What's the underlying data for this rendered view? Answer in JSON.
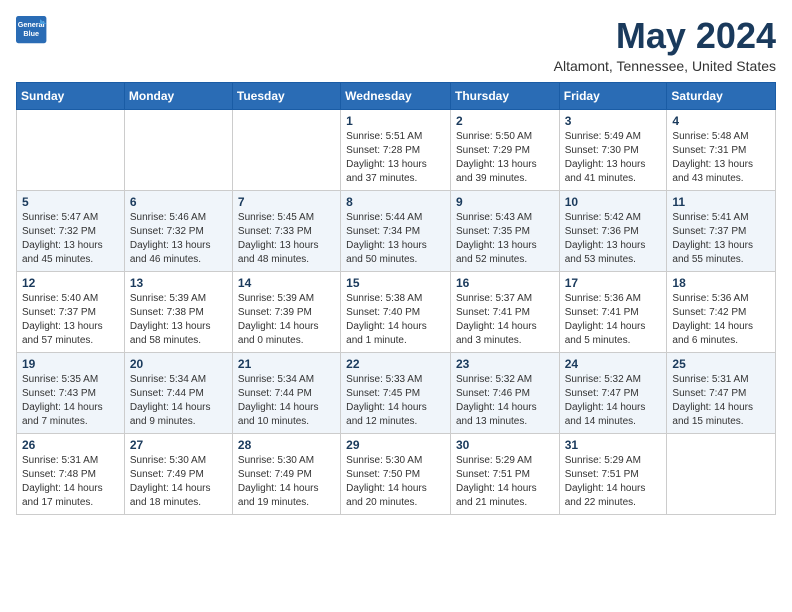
{
  "header": {
    "logo_line1": "General",
    "logo_line2": "Blue",
    "month_title": "May 2024",
    "location": "Altamont, Tennessee, United States"
  },
  "days_of_week": [
    "Sunday",
    "Monday",
    "Tuesday",
    "Wednesday",
    "Thursday",
    "Friday",
    "Saturday"
  ],
  "weeks": [
    [
      {
        "day": "",
        "sunrise": "",
        "sunset": "",
        "daylight": ""
      },
      {
        "day": "",
        "sunrise": "",
        "sunset": "",
        "daylight": ""
      },
      {
        "day": "",
        "sunrise": "",
        "sunset": "",
        "daylight": ""
      },
      {
        "day": "1",
        "sunrise": "Sunrise: 5:51 AM",
        "sunset": "Sunset: 7:28 PM",
        "daylight": "Daylight: 13 hours and 37 minutes."
      },
      {
        "day": "2",
        "sunrise": "Sunrise: 5:50 AM",
        "sunset": "Sunset: 7:29 PM",
        "daylight": "Daylight: 13 hours and 39 minutes."
      },
      {
        "day": "3",
        "sunrise": "Sunrise: 5:49 AM",
        "sunset": "Sunset: 7:30 PM",
        "daylight": "Daylight: 13 hours and 41 minutes."
      },
      {
        "day": "4",
        "sunrise": "Sunrise: 5:48 AM",
        "sunset": "Sunset: 7:31 PM",
        "daylight": "Daylight: 13 hours and 43 minutes."
      }
    ],
    [
      {
        "day": "5",
        "sunrise": "Sunrise: 5:47 AM",
        "sunset": "Sunset: 7:32 PM",
        "daylight": "Daylight: 13 hours and 45 minutes."
      },
      {
        "day": "6",
        "sunrise": "Sunrise: 5:46 AM",
        "sunset": "Sunset: 7:32 PM",
        "daylight": "Daylight: 13 hours and 46 minutes."
      },
      {
        "day": "7",
        "sunrise": "Sunrise: 5:45 AM",
        "sunset": "Sunset: 7:33 PM",
        "daylight": "Daylight: 13 hours and 48 minutes."
      },
      {
        "day": "8",
        "sunrise": "Sunrise: 5:44 AM",
        "sunset": "Sunset: 7:34 PM",
        "daylight": "Daylight: 13 hours and 50 minutes."
      },
      {
        "day": "9",
        "sunrise": "Sunrise: 5:43 AM",
        "sunset": "Sunset: 7:35 PM",
        "daylight": "Daylight: 13 hours and 52 minutes."
      },
      {
        "day": "10",
        "sunrise": "Sunrise: 5:42 AM",
        "sunset": "Sunset: 7:36 PM",
        "daylight": "Daylight: 13 hours and 53 minutes."
      },
      {
        "day": "11",
        "sunrise": "Sunrise: 5:41 AM",
        "sunset": "Sunset: 7:37 PM",
        "daylight": "Daylight: 13 hours and 55 minutes."
      }
    ],
    [
      {
        "day": "12",
        "sunrise": "Sunrise: 5:40 AM",
        "sunset": "Sunset: 7:37 PM",
        "daylight": "Daylight: 13 hours and 57 minutes."
      },
      {
        "day": "13",
        "sunrise": "Sunrise: 5:39 AM",
        "sunset": "Sunset: 7:38 PM",
        "daylight": "Daylight: 13 hours and 58 minutes."
      },
      {
        "day": "14",
        "sunrise": "Sunrise: 5:39 AM",
        "sunset": "Sunset: 7:39 PM",
        "daylight": "Daylight: 14 hours and 0 minutes."
      },
      {
        "day": "15",
        "sunrise": "Sunrise: 5:38 AM",
        "sunset": "Sunset: 7:40 PM",
        "daylight": "Daylight: 14 hours and 1 minute."
      },
      {
        "day": "16",
        "sunrise": "Sunrise: 5:37 AM",
        "sunset": "Sunset: 7:41 PM",
        "daylight": "Daylight: 14 hours and 3 minutes."
      },
      {
        "day": "17",
        "sunrise": "Sunrise: 5:36 AM",
        "sunset": "Sunset: 7:41 PM",
        "daylight": "Daylight: 14 hours and 5 minutes."
      },
      {
        "day": "18",
        "sunrise": "Sunrise: 5:36 AM",
        "sunset": "Sunset: 7:42 PM",
        "daylight": "Daylight: 14 hours and 6 minutes."
      }
    ],
    [
      {
        "day": "19",
        "sunrise": "Sunrise: 5:35 AM",
        "sunset": "Sunset: 7:43 PM",
        "daylight": "Daylight: 14 hours and 7 minutes."
      },
      {
        "day": "20",
        "sunrise": "Sunrise: 5:34 AM",
        "sunset": "Sunset: 7:44 PM",
        "daylight": "Daylight: 14 hours and 9 minutes."
      },
      {
        "day": "21",
        "sunrise": "Sunrise: 5:34 AM",
        "sunset": "Sunset: 7:44 PM",
        "daylight": "Daylight: 14 hours and 10 minutes."
      },
      {
        "day": "22",
        "sunrise": "Sunrise: 5:33 AM",
        "sunset": "Sunset: 7:45 PM",
        "daylight": "Daylight: 14 hours and 12 minutes."
      },
      {
        "day": "23",
        "sunrise": "Sunrise: 5:32 AM",
        "sunset": "Sunset: 7:46 PM",
        "daylight": "Daylight: 14 hours and 13 minutes."
      },
      {
        "day": "24",
        "sunrise": "Sunrise: 5:32 AM",
        "sunset": "Sunset: 7:47 PM",
        "daylight": "Daylight: 14 hours and 14 minutes."
      },
      {
        "day": "25",
        "sunrise": "Sunrise: 5:31 AM",
        "sunset": "Sunset: 7:47 PM",
        "daylight": "Daylight: 14 hours and 15 minutes."
      }
    ],
    [
      {
        "day": "26",
        "sunrise": "Sunrise: 5:31 AM",
        "sunset": "Sunset: 7:48 PM",
        "daylight": "Daylight: 14 hours and 17 minutes."
      },
      {
        "day": "27",
        "sunrise": "Sunrise: 5:30 AM",
        "sunset": "Sunset: 7:49 PM",
        "daylight": "Daylight: 14 hours and 18 minutes."
      },
      {
        "day": "28",
        "sunrise": "Sunrise: 5:30 AM",
        "sunset": "Sunset: 7:49 PM",
        "daylight": "Daylight: 14 hours and 19 minutes."
      },
      {
        "day": "29",
        "sunrise": "Sunrise: 5:30 AM",
        "sunset": "Sunset: 7:50 PM",
        "daylight": "Daylight: 14 hours and 20 minutes."
      },
      {
        "day": "30",
        "sunrise": "Sunrise: 5:29 AM",
        "sunset": "Sunset: 7:51 PM",
        "daylight": "Daylight: 14 hours and 21 minutes."
      },
      {
        "day": "31",
        "sunrise": "Sunrise: 5:29 AM",
        "sunset": "Sunset: 7:51 PM",
        "daylight": "Daylight: 14 hours and 22 minutes."
      },
      {
        "day": "",
        "sunrise": "",
        "sunset": "",
        "daylight": ""
      }
    ]
  ]
}
